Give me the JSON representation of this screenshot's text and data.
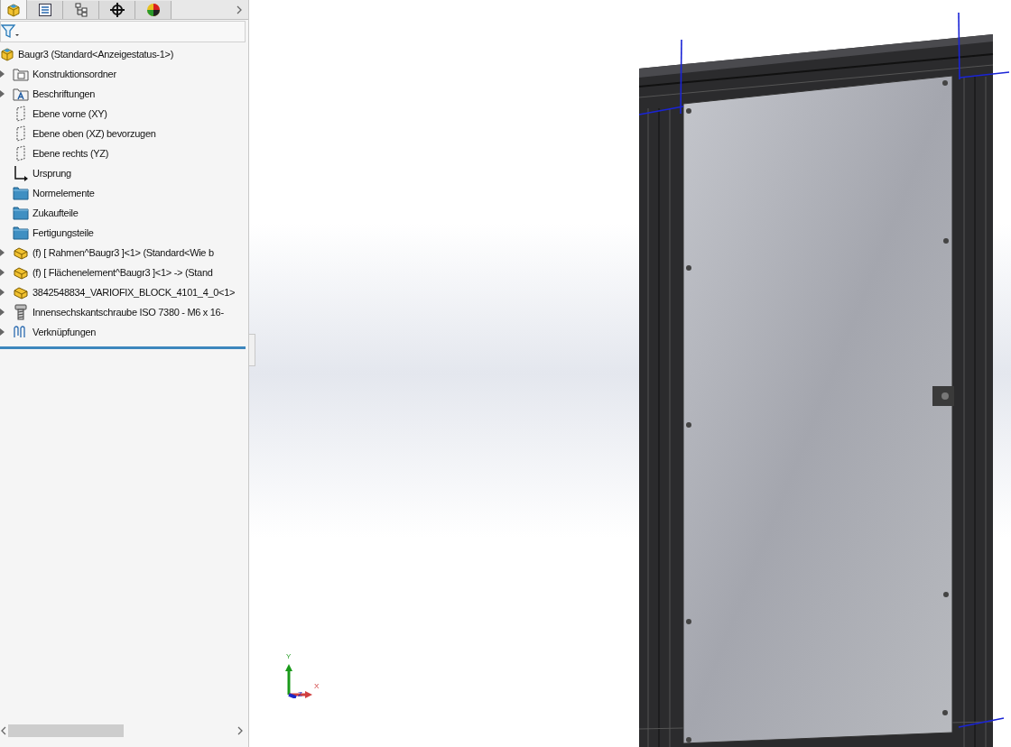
{
  "panel_tabs": [
    {
      "kind": "feature",
      "selected": true
    },
    {
      "kind": "property",
      "selected": false
    },
    {
      "kind": "config",
      "selected": false
    },
    {
      "kind": "dim",
      "selected": false
    },
    {
      "kind": "display",
      "selected": false
    }
  ],
  "tree": {
    "root": "Baugr3  (Standard<Anzeigestatus-1>)",
    "items": [
      {
        "kind": "folder-doc",
        "label": "Konstruktionsordner",
        "collapsible": true
      },
      {
        "kind": "folder-annot",
        "label": "Beschriftungen",
        "collapsible": true
      },
      {
        "kind": "plane",
        "label": "Ebene vorne (XY)",
        "collapsible": false
      },
      {
        "kind": "plane",
        "label": "Ebene oben (XZ) bevorzugen",
        "collapsible": false
      },
      {
        "kind": "plane",
        "label": "Ebene rechts (YZ)",
        "collapsible": false
      },
      {
        "kind": "origin",
        "label": "Ursprung",
        "collapsible": false
      },
      {
        "kind": "folder",
        "label": "Normelemente",
        "collapsible": false
      },
      {
        "kind": "folder",
        "label": "Zukaufteile",
        "collapsible": false
      },
      {
        "kind": "folder",
        "label": "Fertigungsteile",
        "collapsible": false
      },
      {
        "kind": "part",
        "label": "(f) [ Rahmen^Baugr3 ]<1> (Standard<Wie b",
        "collapsible": true
      },
      {
        "kind": "part",
        "label": "(f) [ Flächenelement^Baugr3 ]<1> -> (Stand",
        "collapsible": true
      },
      {
        "kind": "part",
        "label": "3842548834_VARIOFIX_BLOCK_4101_4_0<1>",
        "collapsible": true
      },
      {
        "kind": "screw",
        "label": "Innensechskantschraube ISO 7380 - M6 x 16-",
        "collapsible": true
      },
      {
        "kind": "mates",
        "label": "Verknüpfungen",
        "collapsible": true
      }
    ]
  },
  "triad": {
    "y": "Y",
    "x": "X",
    "z": "Z"
  }
}
